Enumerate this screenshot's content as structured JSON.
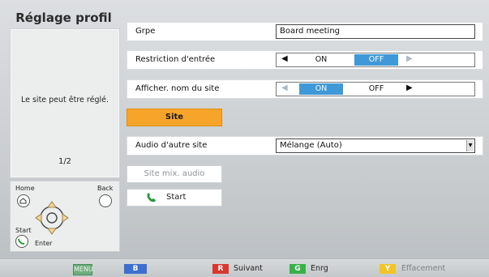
{
  "left": {
    "title": "Réglage profil",
    "info": "Le site peut être réglé.",
    "page": "1/2",
    "remote": {
      "home": "Home",
      "back": "Back",
      "start": "Start",
      "enter": "Enter"
    }
  },
  "rows": {
    "grpe": {
      "label": "Grpe",
      "value": "Board meeting"
    },
    "restriction": {
      "label": "Restriction d'entrée",
      "on": "ON",
      "off": "OFF",
      "selected": "OFF"
    },
    "afficher": {
      "label": "Afficher. nom du site",
      "on": "ON",
      "off": "OFF",
      "selected": "ON"
    },
    "audio": {
      "label": "Audio d'autre site",
      "value": "Mélange (Auto)"
    }
  },
  "buttons": {
    "site": "Site",
    "mix": "Site mix. audio",
    "start": "Start"
  },
  "bottom_bar": {
    "menu": "MENU",
    "b": "B",
    "r": "R",
    "r_label": "Suivant",
    "g": "G",
    "g_label": "Enrg",
    "y": "Y",
    "y_label": "Effacement"
  },
  "colors": {
    "selected_toggle": "#3f98d8",
    "site_button": "#f6a52a",
    "key_b": "#3d6fd0",
    "key_r": "#d9372f",
    "key_g": "#37b24a",
    "key_y": "#f2c428"
  }
}
